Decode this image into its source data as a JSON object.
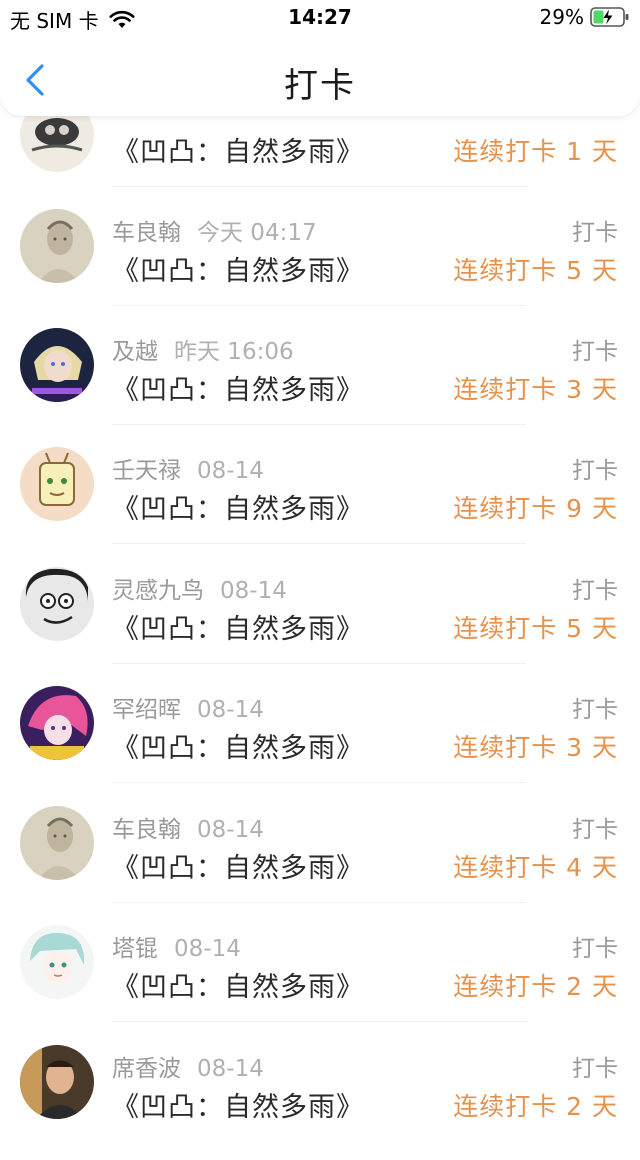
{
  "status_bar": {
    "carrier": "无 SIM 卡",
    "time": "14:27",
    "battery": "29%"
  },
  "header": {
    "title": "打卡"
  },
  "colors": {
    "accent": "#e8914a",
    "meta_text": "#9a9a9a",
    "back_icon": "#2f8ff5"
  },
  "items": [
    {
      "name": "",
      "date": "",
      "action": "",
      "book": "《凹凸：自然多雨》",
      "streak": "连续打卡 1 天",
      "avatar": "avatar-dark-logo"
    },
    {
      "name": "车良翰",
      "date": "今天 04:17",
      "action": "打卡",
      "book": "《凹凸：自然多雨》",
      "streak": "连续打卡 5 天",
      "avatar": "avatar-sketch-man"
    },
    {
      "name": "及越",
      "date": "昨天 16:06",
      "action": "打卡",
      "book": "《凹凸：自然多雨》",
      "streak": "连续打卡 3 天",
      "avatar": "avatar-blonde-anime"
    },
    {
      "name": "壬天禄",
      "date": "08-14",
      "action": "打卡",
      "book": "《凹凸：自然多雨》",
      "streak": "连续打卡 9 天",
      "avatar": "avatar-cartoon-green"
    },
    {
      "name": "灵感九鸟",
      "date": "08-14",
      "action": "打卡",
      "book": "《凹凸：自然多雨》",
      "streak": "连续打卡 5 天",
      "avatar": "avatar-meme-face"
    },
    {
      "name": "罕绍晖",
      "date": "08-14",
      "action": "打卡",
      "book": "《凹凸：自然多雨》",
      "streak": "连续打卡 3 天",
      "avatar": "avatar-pink-anime"
    },
    {
      "name": "车良翰",
      "date": "08-14",
      "action": "打卡",
      "book": "《凹凸：自然多雨》",
      "streak": "连续打卡 4 天",
      "avatar": "avatar-sketch-man"
    },
    {
      "name": "塔锟",
      "date": "08-14",
      "action": "打卡",
      "book": "《凹凸：自然多雨》",
      "streak": "连续打卡 2 天",
      "avatar": "avatar-teal-anime"
    },
    {
      "name": "席香波",
      "date": "08-14",
      "action": "打卡",
      "book": "《凹凸：自然多雨》",
      "streak": "连续打卡 2 天",
      "avatar": "avatar-photo-man"
    }
  ]
}
